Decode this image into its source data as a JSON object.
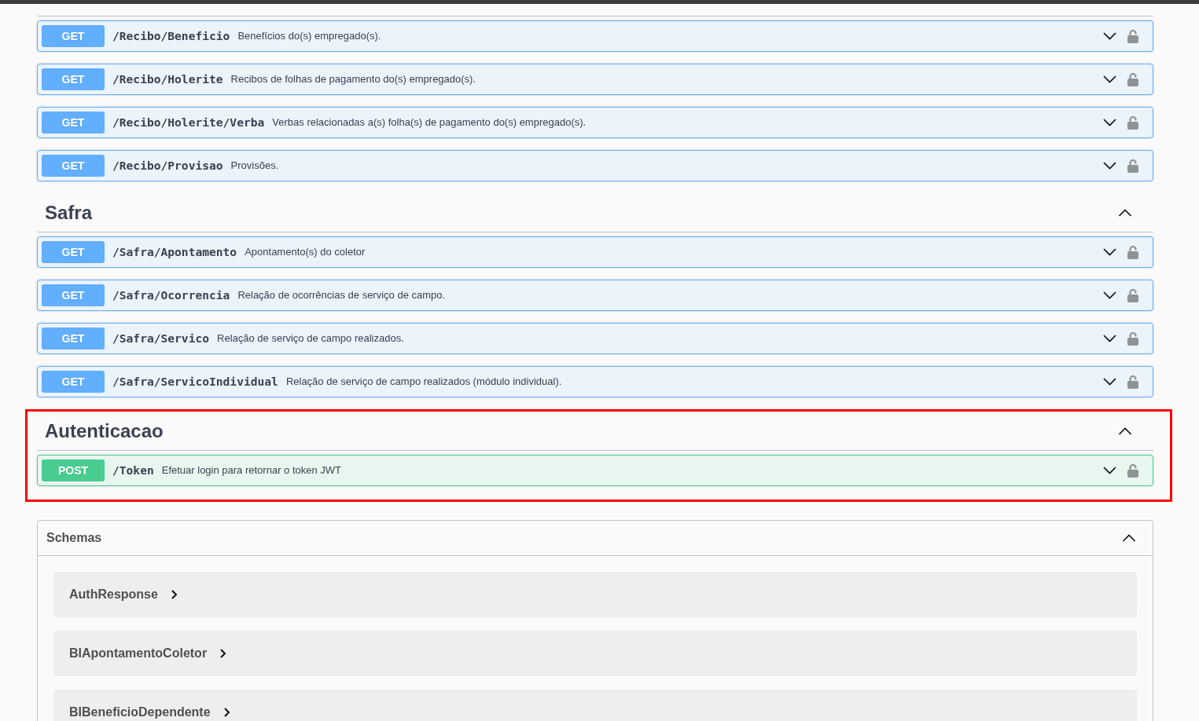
{
  "sections": [
    {
      "highlighted": false,
      "operations": [
        {
          "kind": "get",
          "method": "GET",
          "path": "/Recibo/Beneficio",
          "description": "Benefícios do(s) empregado(s).",
          "expanded": false,
          "locked": false
        },
        {
          "kind": "get",
          "method": "GET",
          "path": "/Recibo/Holerite",
          "description": "Recibos de folhas de pagamento do(s) empregado(s).",
          "expanded": false,
          "locked": false
        },
        {
          "kind": "get",
          "method": "GET",
          "path": "/Recibo/Holerite/Verba",
          "description": "Verbas relacionadas a(s) folha(s) de pagamento do(s) empregado(s).",
          "expanded": false,
          "locked": false
        },
        {
          "kind": "get",
          "method": "GET",
          "path": "/Recibo/Provisao",
          "description": "Provisões.",
          "expanded": false,
          "locked": false
        }
      ]
    },
    {
      "title": "Safra",
      "expanded": true,
      "highlighted": false,
      "operations": [
        {
          "kind": "get",
          "method": "GET",
          "path": "/Safra/Apontamento",
          "description": "Apontamento(s) do coletor",
          "expanded": false,
          "locked": false
        },
        {
          "kind": "get",
          "method": "GET",
          "path": "/Safra/Ocorrencia",
          "description": "Relação de ocorrências de serviço de campo.",
          "expanded": false,
          "locked": false
        },
        {
          "kind": "get",
          "method": "GET",
          "path": "/Safra/Servico",
          "description": "Relação de serviço de campo realizados.",
          "expanded": false,
          "locked": false
        },
        {
          "kind": "get",
          "method": "GET",
          "path": "/Safra/ServicoIndividual",
          "description": "Relação de serviço de campo realizados (módulo individual).",
          "expanded": false,
          "locked": false
        }
      ]
    },
    {
      "title": "Autenticacao",
      "expanded": true,
      "highlighted": true,
      "operations": [
        {
          "kind": "post",
          "method": "POST",
          "path": "/Token",
          "description": "Efetuar login para retornar o token JWT",
          "expanded": false,
          "locked": false
        }
      ]
    }
  ],
  "schemas": {
    "title": "Schemas",
    "expanded": true,
    "items": [
      {
        "name": "AuthResponse",
        "expanded": false
      },
      {
        "name": "BIApontamentoColetor",
        "expanded": false
      },
      {
        "name": "BIBeneficioDependente",
        "expanded": false
      }
    ]
  }
}
